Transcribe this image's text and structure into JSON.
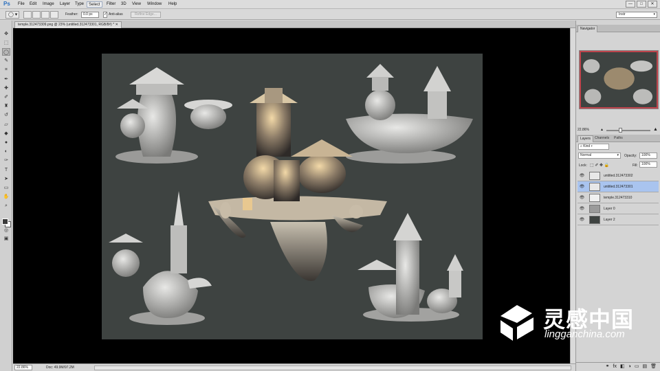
{
  "app": {
    "logo": "Ps"
  },
  "menu": [
    "File",
    "Edit",
    "Image",
    "Layer",
    "Type",
    "Select",
    "Filter",
    "3D",
    "View",
    "Window",
    "Help"
  ],
  "menu_active": "Select",
  "window_controls": [
    "—",
    "□",
    "✕"
  ],
  "options": {
    "feather_label": "Feather:",
    "feather_value": "0.0 px",
    "antialias_label": "Anti-alias",
    "refine_label": "Refine Edge...",
    "workspace": "Instr"
  },
  "document": {
    "tab_title": "temple.312473309.png @ 23% (untitled.312473301, RGB/8#) *",
    "zoom": "22.86%",
    "doc_size": "Doc: 49.9M/97.2M"
  },
  "tools": [
    {
      "icon": "move-icon",
      "glyph": "✥"
    },
    {
      "icon": "marquee-icon",
      "glyph": "⬚"
    },
    {
      "icon": "lasso-icon",
      "glyph": "◯"
    },
    {
      "icon": "quick-select-icon",
      "glyph": "✎"
    },
    {
      "icon": "crop-icon",
      "glyph": "⌗"
    },
    {
      "icon": "eyedropper-icon",
      "glyph": "✒"
    },
    {
      "icon": "healing-icon",
      "glyph": "✚"
    },
    {
      "icon": "brush-icon",
      "glyph": "✐"
    },
    {
      "icon": "stamp-icon",
      "glyph": "♜"
    },
    {
      "icon": "history-brush-icon",
      "glyph": "↺"
    },
    {
      "icon": "eraser-icon",
      "glyph": "▱"
    },
    {
      "icon": "bucket-icon",
      "glyph": "◆"
    },
    {
      "icon": "blur-icon",
      "glyph": "●"
    },
    {
      "icon": "dodge-icon",
      "glyph": "◐"
    },
    {
      "icon": "pen-icon",
      "glyph": "✑"
    },
    {
      "icon": "type-icon",
      "glyph": "T"
    },
    {
      "icon": "path-select-icon",
      "glyph": "➤"
    },
    {
      "icon": "shape-icon",
      "glyph": "▭"
    },
    {
      "icon": "hand-icon",
      "glyph": "✋"
    },
    {
      "icon": "zoom-icon",
      "glyph": "⌕"
    },
    {
      "icon": "quick-mask-icon",
      "glyph": "◎"
    },
    {
      "icon": "screen-mode-icon",
      "glyph": "▣"
    }
  ],
  "navigator": {
    "tab": "Navigator",
    "zoom": "22.86%"
  },
  "layers_panel": {
    "tabs": [
      "Layers",
      "Channels",
      "Paths"
    ],
    "kind": "Kind",
    "blend_mode": "Normal",
    "opacity_label": "Opacity:",
    "opacity": "100%",
    "lock_label": "Lock:",
    "fill_label": "Fill:",
    "fill": "100%",
    "layers": [
      {
        "name": "untitled.312473302",
        "selected": false
      },
      {
        "name": "untitled.312473301",
        "selected": true
      },
      {
        "name": "temple.312473310",
        "selected": false
      },
      {
        "name": "Layer 0",
        "selected": false
      },
      {
        "name": "Layer 2",
        "selected": false
      }
    ],
    "footer_icons": [
      "⚭",
      "fx",
      "◧",
      "◑",
      "▭",
      "▤",
      "🗑"
    ]
  },
  "watermark": {
    "brand": "灵感中国",
    "url": "lingganchina.com"
  },
  "colors": {
    "accent": "#2b6fbf",
    "selection": "#a9c4ef",
    "canvas_bg": "#3e4341",
    "nav_frame": "#c0454d"
  }
}
